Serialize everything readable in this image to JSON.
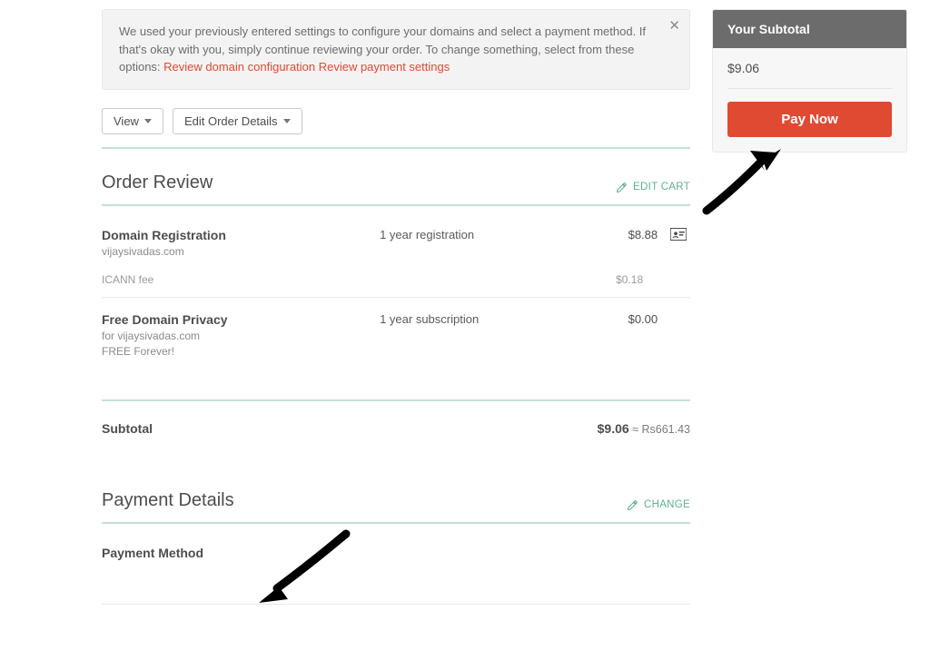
{
  "notice": {
    "text_before_link": "We used your previously entered settings to configure your domains and select a payment method. If that's okay with you, simply continue reviewing your order. To change something, select from these options: ",
    "link1": "Review domain configuration",
    "link2": "Review payment settings"
  },
  "toolbar": {
    "view": "View",
    "edit": "Edit Order Details"
  },
  "order": {
    "title": "Order Review",
    "action": "EDIT CART",
    "items": [
      {
        "title": "Domain Registration",
        "sub": "vijaysivadas.com",
        "mid": "1 year registration",
        "price": "$8.88",
        "has_icon": true,
        "fee_label": "ICANN fee",
        "fee_price": "$0.18"
      },
      {
        "title": "Free Domain Privacy",
        "sub": "for vijaysivadas.com\nFREE Forever!",
        "mid": "1 year subscription",
        "price": "$0.00",
        "has_icon": false
      }
    ],
    "subtotal_label": "Subtotal",
    "subtotal_price": "$9.06",
    "subtotal_approx": " ≈ Rs661.43"
  },
  "payment": {
    "title": "Payment Details",
    "action": "CHANGE",
    "method_label": "Payment Method"
  },
  "sidebar": {
    "title": "Your Subtotal",
    "amount": "$9.06",
    "pay_label": "Pay Now"
  }
}
